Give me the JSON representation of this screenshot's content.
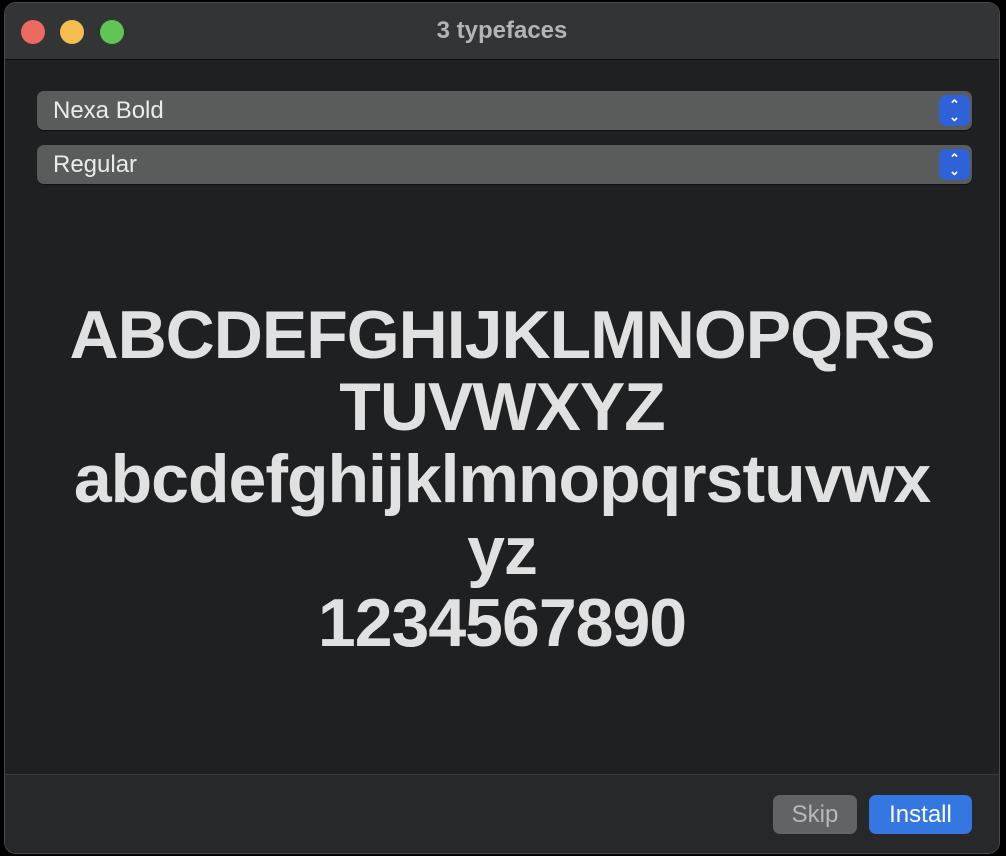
{
  "window": {
    "title": "3 typefaces"
  },
  "family_select": {
    "value": "Nexa Bold"
  },
  "style_select": {
    "value": "Regular"
  },
  "sample": {
    "lines": [
      "ABCDEFGHIJKLMNOPQRS",
      "TUVWXYZ",
      "abcdefghijklmnopqrstuvwx",
      "yz",
      "1234567890"
    ]
  },
  "footer": {
    "skip_label": "Skip",
    "install_label": "Install"
  },
  "colors": {
    "accent": "#3477e0",
    "close": "#ed6a5e",
    "minimize": "#f5bf4f",
    "zoom": "#61c554"
  }
}
